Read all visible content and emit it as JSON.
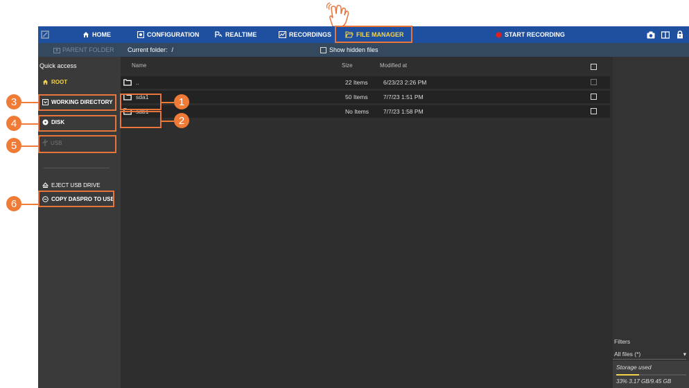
{
  "topbar": {
    "home": "HOME",
    "configuration": "CONFIGURATION",
    "realtime": "REALTIME",
    "recordings": "RECORDINGS",
    "file_manager": "FILE MANAGER",
    "start_recording": "START RECORDING"
  },
  "subbar": {
    "parent_folder": "PARENT FOLDER",
    "current_folder_label": "Current folder:",
    "current_folder_value": "/",
    "show_hidden": "Show hidden files"
  },
  "sidebar": {
    "quick_access": "Quick access",
    "root": "ROOT",
    "working_directory": "WORKING DIRECTORY",
    "disk": "DISK",
    "usb": "USB",
    "eject_usb": "EJECT USB DRIVE",
    "copy_daspro": "COPY DASPRO TO USB"
  },
  "list": {
    "columns": {
      "name": "Name",
      "size": "Size",
      "modified": "Modified at"
    },
    "rows": [
      {
        "name": "..",
        "size": "22 Items",
        "modified": "6/23/23 2:26 PM"
      },
      {
        "name": "sda1",
        "size": "50 Items",
        "modified": "7/7/23 1:51 PM"
      },
      {
        "name": "sdb1",
        "size": "No Items",
        "modified": "7/7/23 1:58 PM"
      }
    ]
  },
  "right_panel": {
    "filters_label": "Filters",
    "filter_value": "All files (*)",
    "storage_label": "Storage used",
    "storage_fraction": 0.33,
    "storage_text": "33% 3.17 GB/9.45 GB"
  },
  "callouts": [
    "1",
    "2",
    "3",
    "4",
    "5",
    "6"
  ],
  "colors": {
    "topbar": "#1f4f9f",
    "accent_yellow": "#f5d44a",
    "highlight": "#e8763c",
    "record": "#e02020"
  }
}
